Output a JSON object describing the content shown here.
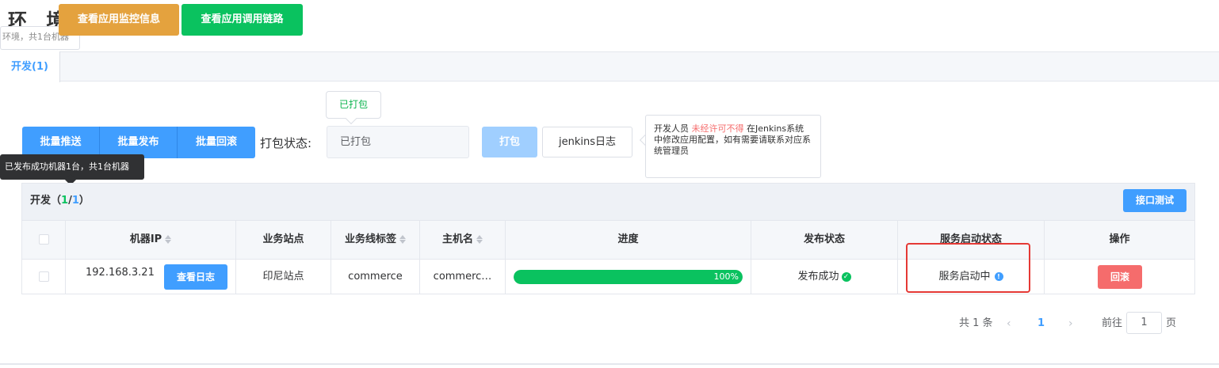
{
  "header": {
    "env_title": "环 境",
    "env_tip": "环境，共1台机器",
    "monitor_button": "查看应用监控信息",
    "trace_button": "查看应用调用链路"
  },
  "tabs": [
    {
      "label": "开发(1)",
      "active": true
    }
  ],
  "controls": {
    "bulk_push": "批量推送",
    "bulk_publish": "批量发布",
    "bulk_rollback": "批量回滚",
    "pack_status_label": "打包状态:",
    "pack_status_value": "已打包",
    "pack_popover": "已打包",
    "pack_button": "打包",
    "jenkins_button": "jenkins日志",
    "jenkins_tip_pre": "开发人员 ",
    "jenkins_tip_warn": "未经许可不得",
    "jenkins_tip_post": " 在Jenkins系统中修改应用配置，如有需要请联系对应系统管理员"
  },
  "publish_tip": "已发布成功机器1台，共1台机器",
  "panel": {
    "title_prefix": "开发（",
    "success_count": "1",
    "separator": "/",
    "total_count": "1",
    "title_suffix": "）",
    "api_test_button": "接口测试"
  },
  "table": {
    "columns": [
      "机器IP",
      "业务站点",
      "业务线标签",
      "主机名",
      "进度",
      "发布状态",
      "服务启动状态",
      "操作"
    ],
    "rows": [
      {
        "ip": "192.168.3.21",
        "log_button": "查看日志",
        "site": "印尼站点",
        "tag": "commerce",
        "hostname": "commerc…",
        "progress_text": "100%",
        "progress": 1.0,
        "publish_status": "发布成功",
        "service_status": "服务启动中",
        "action": "回滚"
      }
    ]
  },
  "pagination": {
    "total": "共 1 条",
    "current": "1",
    "goto_label": "前往",
    "goto_value": "1",
    "page_suffix": "页"
  },
  "colors": {
    "primary": "#409eff",
    "success": "#0ac25f",
    "warning": "#e4a23e",
    "danger": "#f56c6c"
  }
}
